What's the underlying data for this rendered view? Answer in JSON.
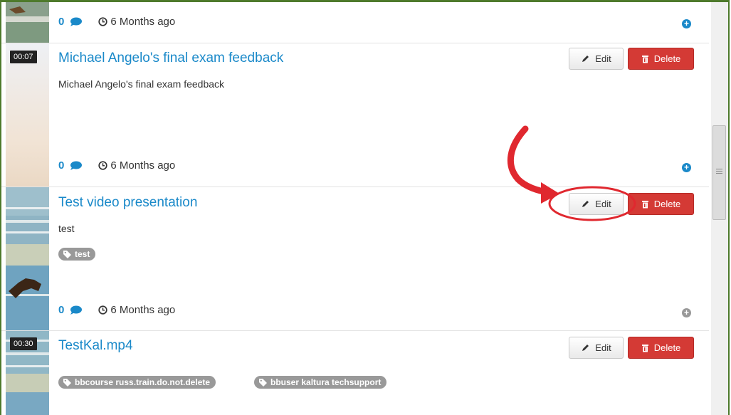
{
  "colors": {
    "accent": "#1a89c9",
    "danger": "#d43a35",
    "frame": "#4e7a2c",
    "tag": "#999999",
    "annotation": "#e0282f"
  },
  "buttons": {
    "edit_label": "Edit",
    "delete_label": "Delete"
  },
  "items": [
    {
      "comments": "0",
      "time": "6 Months ago",
      "action_icon": "plus-circle-icon"
    },
    {
      "duration": "00:07",
      "title": "Michael Angelo's final exam feedback",
      "description": "Michael Angelo's final exam feedback",
      "comments": "0",
      "time": "6 Months ago",
      "action_icon": "plus-circle-icon"
    },
    {
      "title": "Test video presentation",
      "description": "test",
      "tags": [
        "test"
      ],
      "comments": "0",
      "time": "6 Months ago",
      "action_icon": "plus-circle-icon"
    },
    {
      "duration": "00:30",
      "title": "TestKal.mp4",
      "tags": [
        "bbcourse russ.train.do.not.delete",
        "bbuser kaltura techsupport"
      ]
    }
  ],
  "icons": {
    "comment": "speech-bubble-icon",
    "clock": "clock-icon",
    "edit": "pencil-icon",
    "delete": "trash-icon",
    "tag": "tag-icon"
  }
}
